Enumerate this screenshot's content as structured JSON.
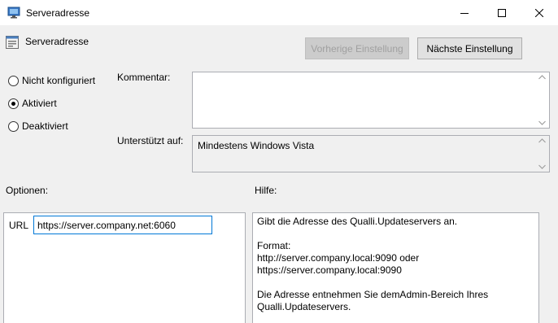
{
  "window": {
    "title": "Serveradresse",
    "controls": {
      "minimize": "minimize",
      "maximize": "maximize",
      "close": "close"
    }
  },
  "header": {
    "policy_title": "Serveradresse",
    "prev_button": "Vorherige Einstellung",
    "next_button": "Nächste Einstellung"
  },
  "state": {
    "options": [
      {
        "label": "Nicht konfiguriert",
        "selected": false
      },
      {
        "label": "Aktiviert",
        "selected": true
      },
      {
        "label": "Deaktiviert",
        "selected": false
      }
    ]
  },
  "comment": {
    "label": "Kommentar:",
    "value": ""
  },
  "supported": {
    "label": "Unterstützt auf:",
    "value": "Mindestens Windows Vista"
  },
  "options_section": {
    "label": "Optionen:",
    "url_label": "URL",
    "url_value": "https://server.company.net:6060"
  },
  "help_section": {
    "label": "Hilfe:",
    "lines": [
      "Gibt die Adresse des Qualli.Updateservers an.",
      "",
      "Format:",
      "http://server.company.local:9090 oder",
      "https://server.company.local:9090",
      "",
      "Die Adresse entnehmen Sie demAdmin-Bereich Ihres",
      "Qualli.Updateservers."
    ]
  },
  "colors": {
    "window_bg": "#f0f0f0",
    "focus_border": "#0078d7",
    "field_border": "#abadb3",
    "disabled_text": "#a0a0a0"
  }
}
